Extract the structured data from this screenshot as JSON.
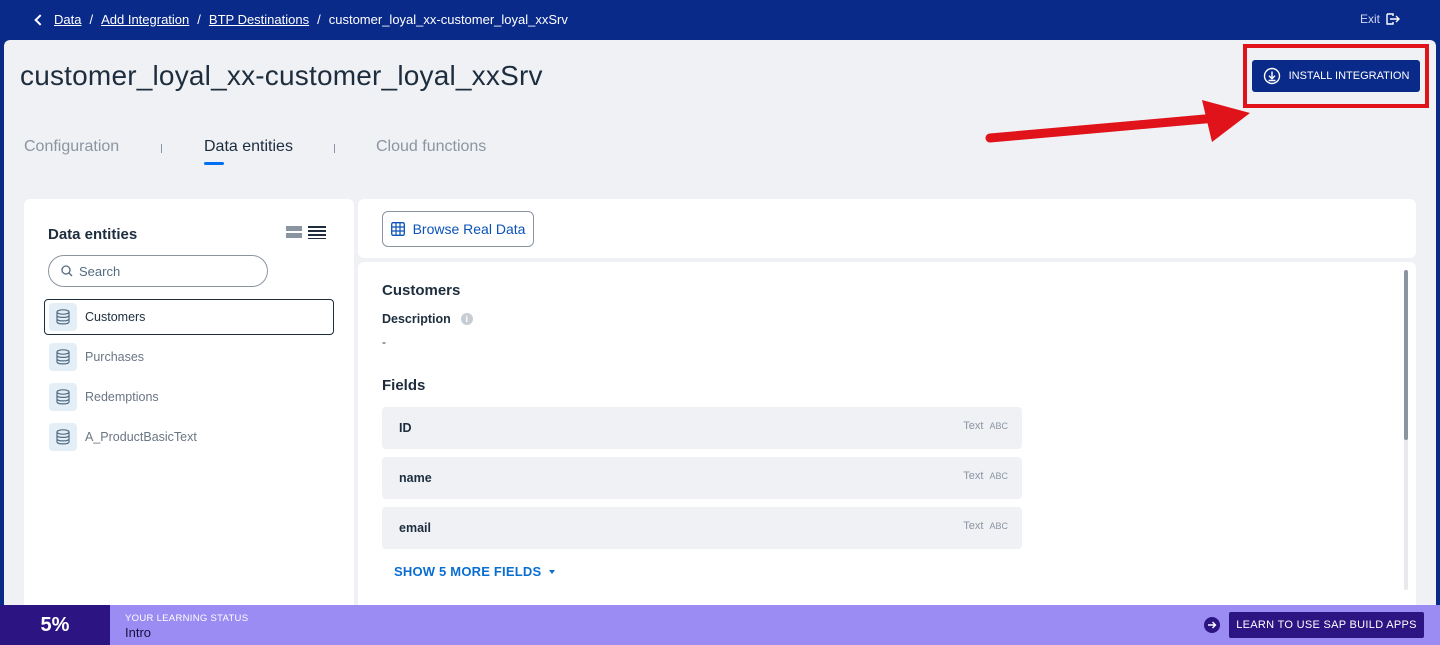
{
  "breadcrumb": {
    "items": [
      "Data",
      "Add Integration",
      "BTP Destinations"
    ],
    "current": "customer_loyal_xx-customer_loyal_xxSrv"
  },
  "exit_label": "Exit",
  "page_title": "customer_loyal_xx-customer_loyal_xxSrv",
  "install_button": "INSTALL INTEGRATION",
  "tabs": [
    {
      "label": "Configuration",
      "active": false
    },
    {
      "label": "Data entities",
      "active": true
    },
    {
      "label": "Cloud functions",
      "active": false
    }
  ],
  "entities_panel": {
    "title": "Data entities",
    "search_placeholder": "Search",
    "items": [
      "Customers",
      "Purchases",
      "Redemptions",
      "A_ProductBasicText"
    ],
    "selected": "Customers"
  },
  "browse_button": "Browse Real Data",
  "detail": {
    "title": "Customers",
    "description_label": "Description",
    "description_value": "-",
    "fields_label": "Fields",
    "fields": [
      {
        "name": "ID",
        "type": "Text"
      },
      {
        "name": "name",
        "type": "Text"
      },
      {
        "name": "email",
        "type": "Text"
      }
    ],
    "type_glyph": "ABC",
    "show_more": "SHOW 5 MORE FIELDS"
  },
  "learning": {
    "percent": "5%",
    "status_label": "YOUR LEARNING STATUS",
    "status_value": "Intro",
    "button": "LEARN TO USE SAP BUILD APPS"
  },
  "colors": {
    "brand": "#0a2a8a",
    "highlight": "#e0121a",
    "link": "#0a6ed1",
    "learn_dark": "#2c1582",
    "learn_light": "#9b8cf4"
  }
}
